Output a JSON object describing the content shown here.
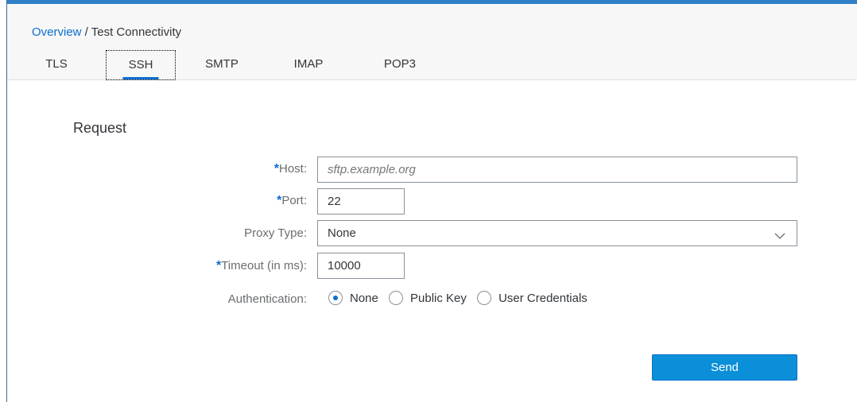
{
  "breadcrumb": {
    "root": "Overview",
    "separator": " / ",
    "current": "Test Connectivity"
  },
  "tabs": [
    {
      "label": "TLS",
      "active": false
    },
    {
      "label": "SSH",
      "active": true
    },
    {
      "label": "SMTP",
      "active": false
    },
    {
      "label": "IMAP",
      "active": false
    },
    {
      "label": "POP3",
      "active": false
    }
  ],
  "request": {
    "title": "Request",
    "host": {
      "label": "Host:",
      "required": true,
      "value": "",
      "placeholder": "sftp.example.org"
    },
    "port": {
      "label": "Port:",
      "required": true,
      "value": "22"
    },
    "proxy_type": {
      "label": "Proxy Type:",
      "required": false,
      "value": "None"
    },
    "timeout": {
      "label": "Timeout (in ms):",
      "required": true,
      "value": "10000"
    },
    "authentication": {
      "label": "Authentication:",
      "options": [
        {
          "label": "None",
          "selected": true
        },
        {
          "label": "Public Key",
          "selected": false
        },
        {
          "label": "User Credentials",
          "selected": false
        }
      ]
    },
    "required_marker": "*",
    "send_label": "Send"
  },
  "colors": {
    "accent": "#0a6ed1",
    "button": "#0a8fd8",
    "topbar": "#2f80c7",
    "header_bg": "#f7f7f7"
  },
  "icons": {
    "proxy_dropdown": "chevron-down-icon"
  }
}
